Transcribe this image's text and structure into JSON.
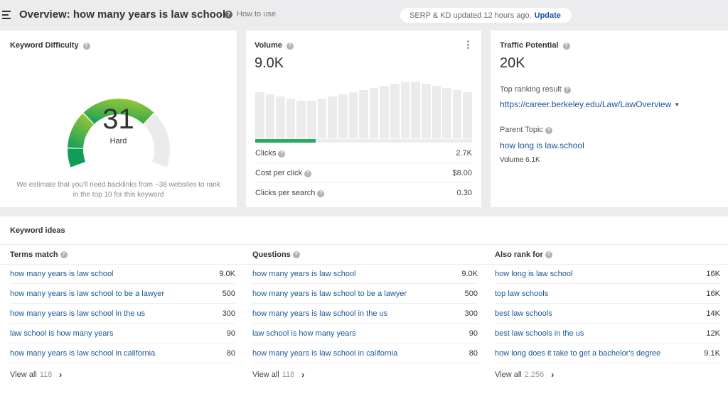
{
  "header": {
    "title": "Overview: how many years is law school",
    "how_to_use": "How to use",
    "serp_status": "SERP & KD updated 12 hours ago.",
    "update_label": "Update"
  },
  "keyword_difficulty": {
    "title": "Keyword Difficulty",
    "value": "31",
    "score": 31,
    "label": "Hard",
    "note_line1": "We estimate that you'll need backlinks from ~38 websites to rank",
    "note_line2": "in the top 10 for this keyword"
  },
  "volume": {
    "title": "Volume",
    "value": "9.0K",
    "trend_relative": [
      0.88,
      0.84,
      0.8,
      0.76,
      0.72,
      0.72,
      0.76,
      0.8,
      0.84,
      0.88,
      0.92,
      0.96,
      1.0,
      1.04,
      1.08,
      1.08,
      1.04,
      1.0,
      0.96,
      0.92,
      0.88
    ],
    "clicks_fraction": 0.28,
    "metrics": [
      {
        "label": "Clicks",
        "value": "2.7K"
      },
      {
        "label": "Cost per click",
        "value": "$8.00"
      },
      {
        "label": "Clicks per search",
        "value": "0.30"
      }
    ]
  },
  "traffic_potential": {
    "title": "Traffic Potential",
    "value": "20K",
    "top_ranking_label": "Top ranking result",
    "top_ranking_url": "https://career.berkeley.edu/Law/LawOverview",
    "parent_topic_label": "Parent Topic",
    "parent_topic": "how long is law.school",
    "parent_volume": "Volume 6.1K"
  },
  "keyword_ideas": {
    "title": "Keyword ideas",
    "columns": [
      {
        "heading": "Terms match",
        "rows": [
          {
            "keyword": "how many years is law school",
            "volume": "9.0K"
          },
          {
            "keyword": "how many years is law school to be a lawyer",
            "volume": "500"
          },
          {
            "keyword": "how many years is law school in the us",
            "volume": "300"
          },
          {
            "keyword": "law school is how many years",
            "volume": "90"
          },
          {
            "keyword": "how many years is law school in california",
            "volume": "80"
          }
        ],
        "view_all": "View all",
        "count": "118"
      },
      {
        "heading": "Questions",
        "rows": [
          {
            "keyword": "how many years is law school",
            "volume": "9.0K"
          },
          {
            "keyword": "how many years is law school to be a lawyer",
            "volume": "500"
          },
          {
            "keyword": "how many years is law school in the us",
            "volume": "300"
          },
          {
            "keyword": "law school is how many years",
            "volume": "90"
          },
          {
            "keyword": "how many years is law school in california",
            "volume": "80"
          }
        ],
        "view_all": "View all",
        "count": "118"
      },
      {
        "heading": "Also rank for",
        "rows": [
          {
            "keyword": "how long is law school",
            "volume": "16K"
          },
          {
            "keyword": "top law schools",
            "volume": "16K"
          },
          {
            "keyword": "best law schools",
            "volume": "14K"
          },
          {
            "keyword": "best law schools in the us",
            "volume": "12K"
          },
          {
            "keyword": "how long does it take to get a bachelor's degree",
            "volume": "9.1K"
          }
        ],
        "view_all": "View all",
        "count": "2,256"
      }
    ]
  },
  "icons": {
    "menu": "hamburger-menu-icon",
    "help": "question-circle-icon",
    "kebab": "vertical-ellipsis-icon",
    "caret": "caret-down-icon",
    "chevron": "chevron-right-icon",
    "help_glyph": "?",
    "caret_glyph": "▼",
    "chevron_glyph": "›"
  },
  "colors": {
    "link": "#1a5599",
    "accent_green": "#2ca862",
    "gauge_dark_green": "#0f9d58",
    "gauge_light_green": "#8cc43a",
    "gauge_track": "#ebebeb",
    "update_link": "#1a4fa0"
  }
}
